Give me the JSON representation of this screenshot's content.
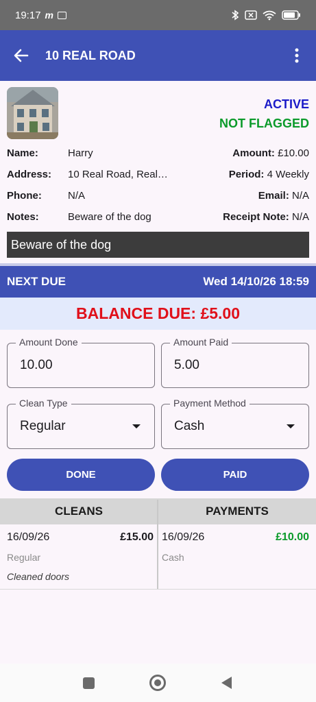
{
  "status": {
    "time": "19:17"
  },
  "appbar": {
    "title": "10 REAL ROAD"
  },
  "property": {
    "state": "ACTIVE",
    "flag_state": "NOT FLAGGED",
    "name_label": "Name:",
    "name": "Harry",
    "address_label": "Address:",
    "address": "10 Real Road, Real…",
    "phone_label": "Phone:",
    "phone": "N/A",
    "notes_label": "Notes:",
    "notes": "Beware of the dog",
    "amount_label": "Amount:",
    "amount": "£10.00",
    "period_label": "Period:",
    "period": "4 Weekly",
    "email_label": "Email:",
    "email": "N/A",
    "receipt_label": "Receipt Note:",
    "receipt": "N/A",
    "notes_banner": "Beware of the dog"
  },
  "next_due": {
    "label": "NEXT DUE",
    "value": "Wed 14/10/26 18:59"
  },
  "balance": {
    "text": "BALANCE DUE: £5.00"
  },
  "form": {
    "amount_done_label": "Amount Done",
    "amount_done": "10.00",
    "amount_paid_label": "Amount Paid",
    "amount_paid": "5.00",
    "clean_type_label": "Clean Type",
    "clean_type": "Regular",
    "payment_method_label": "Payment Method",
    "payment_method": "Cash",
    "done_label": "DONE",
    "paid_label": "PAID"
  },
  "history": {
    "cleans_header": "CLEANS",
    "payments_header": "PAYMENTS",
    "cleans": [
      {
        "date": "16/09/26",
        "amount": "£15.00",
        "type": "Regular",
        "note": "Cleaned doors"
      }
    ],
    "payments": [
      {
        "date": "16/09/26",
        "amount": "£10.00",
        "method": "Cash"
      }
    ]
  },
  "colors": {
    "primary": "#3f51b5",
    "active": "#1a1ac8",
    "ok_green": "#0a9a2a",
    "balance_red": "#e0101a"
  }
}
